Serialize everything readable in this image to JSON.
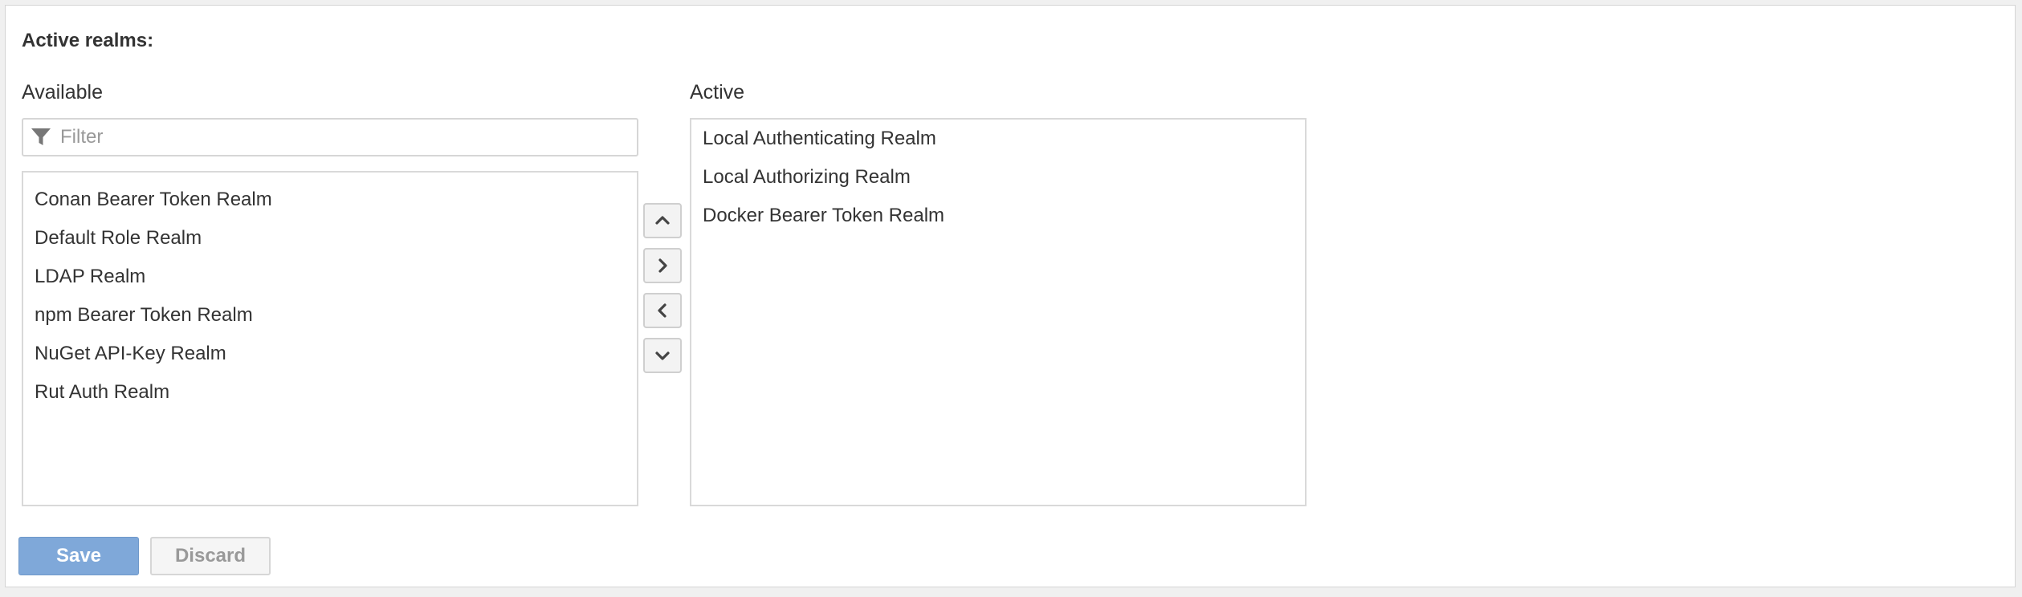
{
  "section_title": "Active realms:",
  "available": {
    "label": "Available",
    "filter_placeholder": "Filter",
    "filter_value": "",
    "items": [
      "Conan Bearer Token Realm",
      "Default Role Realm",
      "LDAP Realm",
      "npm Bearer Token Realm",
      "NuGet API-Key Realm",
      "Rut Auth Realm"
    ]
  },
  "active": {
    "label": "Active",
    "items": [
      "Local Authenticating Realm",
      "Local Authorizing Realm",
      "Docker Bearer Token Realm"
    ]
  },
  "arrows": {
    "icons": [
      "chevron-up-icon",
      "chevron-right-icon",
      "chevron-left-icon",
      "chevron-down-icon"
    ]
  },
  "actions": {
    "save_label": "Save",
    "discard_label": "Discard"
  },
  "colors": {
    "save_button": "#7fa8d9",
    "discard_text": "#999999",
    "border": "#d9d9d9"
  }
}
